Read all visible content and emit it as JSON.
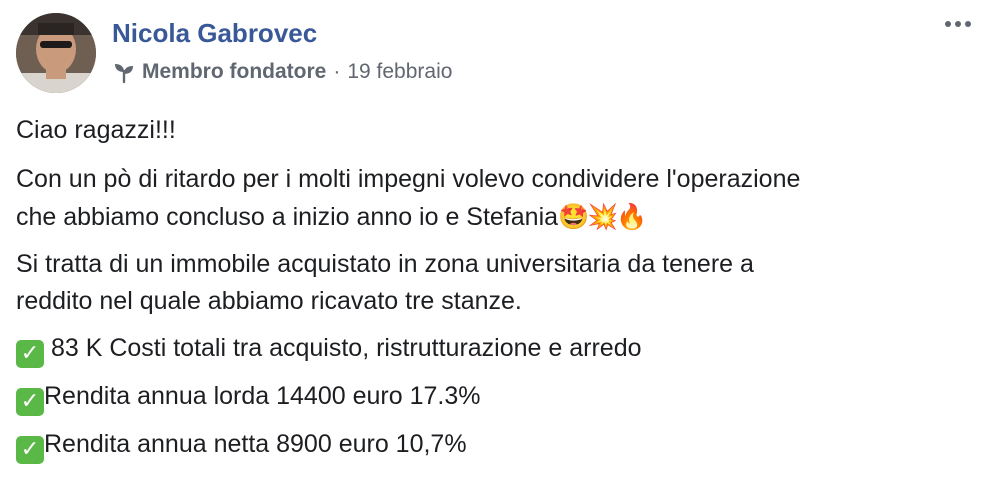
{
  "post": {
    "author": "Nicola Gabrovec",
    "badge": "Membro fondatore",
    "separator": "·",
    "date": "19 febbraio",
    "more_icon": "more-options-icon",
    "badge_icon": "sprout-icon",
    "body": {
      "greeting": "Ciao ragazzi!!!",
      "para1_line1": "Con un pò di ritardo per i molti impegni volevo condividere l'operazione",
      "para1_line2": "che abbiamo concluso a inizio anno io e Stefania",
      "emojis": [
        "🤩",
        "💥",
        "🔥"
      ],
      "para2_line1": "Si tratta di un immobile acquistato in zona universitaria da tenere a",
      "para2_line2": "reddito nel quale abbiamo ricavato tre stanze.",
      "check_mark": "✓",
      "items": [
        " 83 K Costi totali tra acquisto, ristrutturazione e arredo",
        "Rendita annua lorda 14400 euro 17.3%",
        "Rendita annua netta 8900 euro 10,7%"
      ]
    }
  }
}
